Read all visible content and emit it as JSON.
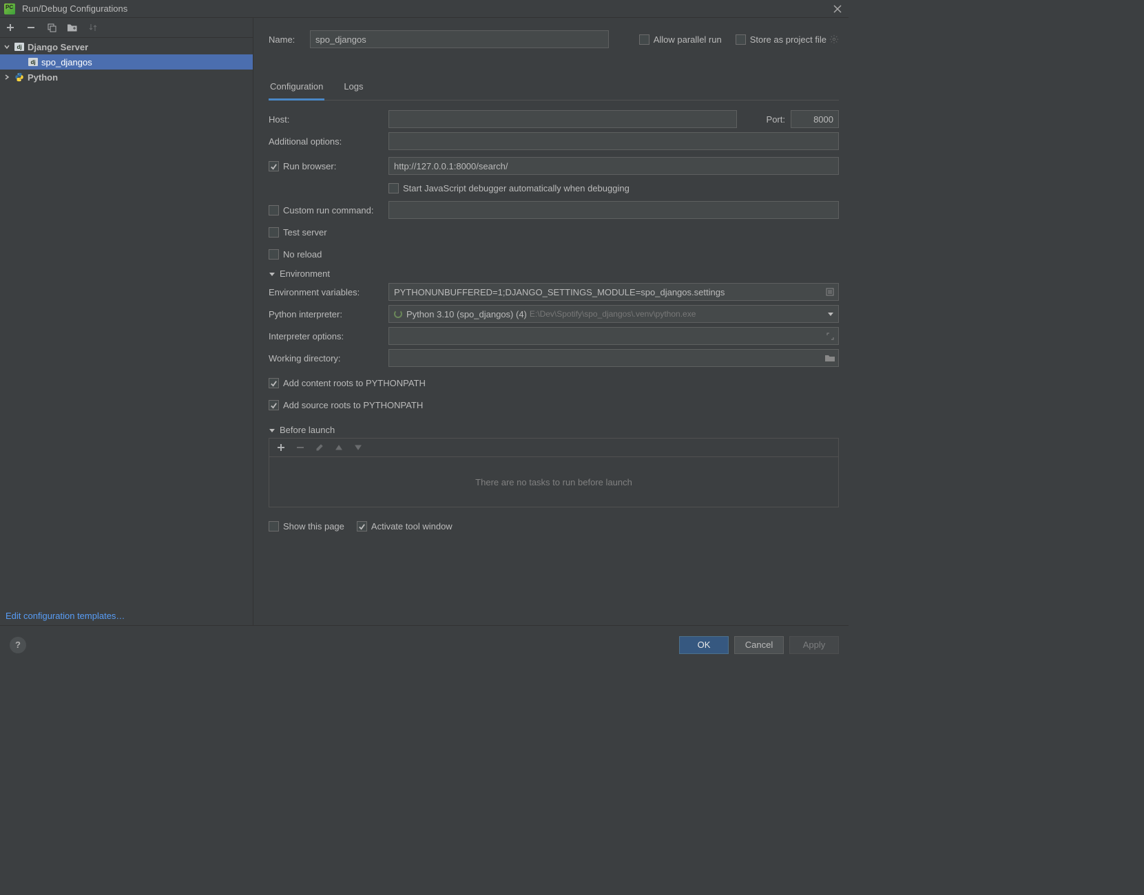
{
  "window": {
    "title": "Run/Debug Configurations"
  },
  "sidebar": {
    "templates_link": "Edit configuration templates…",
    "items": [
      {
        "label": "Django Server"
      },
      {
        "label": "spo_djangos"
      },
      {
        "label": "Python"
      }
    ]
  },
  "form": {
    "name_label": "Name:",
    "name_value": "spo_djangos",
    "allow_parallel": "Allow parallel run",
    "store_as_project": "Store as project file",
    "tabs": {
      "configuration": "Configuration",
      "logs": "Logs"
    },
    "host_label": "Host:",
    "port_label": "Port:",
    "port_value": "8000",
    "addl_options_label": "Additional options:",
    "run_browser_label": "Run browser:",
    "run_browser_url": "http://127.0.0.1:8000/search/",
    "start_js_debugger": "Start JavaScript debugger automatically when debugging",
    "custom_run_cmd": "Custom run command:",
    "test_server": "Test server",
    "no_reload": "No reload",
    "env_header": "Environment",
    "env_vars_label": "Environment variables:",
    "env_vars_value": "PYTHONUNBUFFERED=1;DJANGO_SETTINGS_MODULE=spo_djangos.settings",
    "interpreter_label": "Python interpreter:",
    "interpreter_main": "Python 3.10 (spo_djangos) (4)",
    "interpreter_sub": "E:\\Dev\\Spotify\\spo_djangos\\.venv\\python.exe",
    "interp_options_label": "Interpreter options:",
    "working_dir_label": "Working directory:",
    "add_content_roots": "Add content roots to PYTHONPATH",
    "add_source_roots": "Add source roots to PYTHONPATH",
    "before_launch_header": "Before launch",
    "before_launch_empty": "There are no tasks to run before launch",
    "show_this_page": "Show this page",
    "activate_tool": "Activate tool window"
  },
  "buttons": {
    "ok": "OK",
    "cancel": "Cancel",
    "apply": "Apply"
  }
}
